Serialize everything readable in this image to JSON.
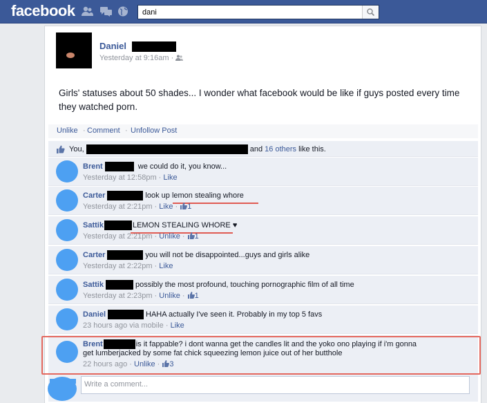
{
  "header": {
    "logo": "facebook",
    "search_value": "dani"
  },
  "post": {
    "author": "Daniel",
    "time": "Yesterday at 9:16am",
    "separator": "·",
    "text": "Girls' statuses about 50 shades... I wonder what facebook would be like if guys posted every time they watched porn.",
    "actions": {
      "unlike": "Unlike",
      "comment": "Comment",
      "unfollow": "Unfollow Post",
      "dot": "·"
    },
    "likes": {
      "you": "You,",
      "and": "and",
      "others": "16 others",
      "suffix": "like this."
    }
  },
  "comments": [
    {
      "name": "Brent",
      "text": "we could do it, you know...",
      "time": "Yesterday at 12:58pm",
      "action": "Like",
      "likes": ""
    },
    {
      "name": "Carter",
      "text_pre": "look up ",
      "text_hl": "lemon stealing whore",
      "time": "Yesterday at 2:21pm",
      "action": "Like",
      "likes": "1"
    },
    {
      "name": "Sattik",
      "text": "LEMON STEALING WHORE ♥",
      "time": "Yesterday at 2:21pm",
      "action": "Unlike",
      "likes": "1"
    },
    {
      "name": "Carter",
      "text": "you will not be disappointed...guys and girls alike",
      "time": "Yesterday at 2:22pm",
      "action": "Like",
      "likes": ""
    },
    {
      "name": "Sattik",
      "text": "possibly the most profound, touching pornographic film of all time",
      "time": "Yesterday at 2:23pm",
      "action": "Unlike",
      "likes": "1"
    },
    {
      "name": "Daniel",
      "text": "HAHA actually I've seen it. Probably in my top 5 favs",
      "time": "23 hours ago via mobile",
      "action": "Like",
      "likes": ""
    },
    {
      "name": "Brent",
      "text": "is it fappable? i dont wanna get the candles lit and the yoko ono playing if i'm gonna",
      "text2": "get lumberjacked by some fat chick squeezing lemon juice out of her butthole",
      "time": "22 hours ago",
      "action": "Unlike",
      "likes": "3"
    }
  ],
  "composer": {
    "placeholder": "Write a comment..."
  },
  "colors": {
    "brand": "#3b5998",
    "highlight": "#e4675d",
    "avatar_blur": "#4da0f2"
  }
}
